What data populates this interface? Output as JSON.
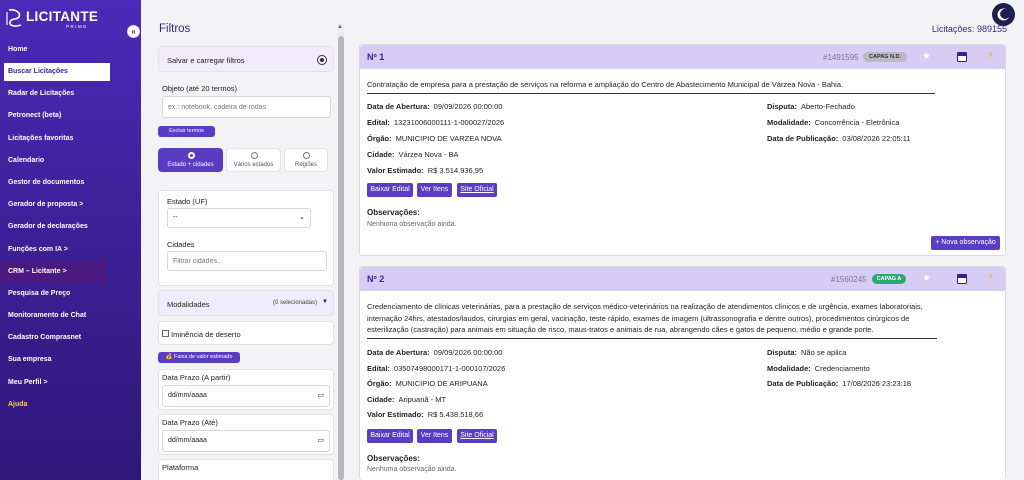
{
  "brand": {
    "name": "LICITANTE",
    "sub": "PRIME"
  },
  "sidebar": {
    "collapse_icon": "«",
    "items": [
      {
        "label": "Home"
      },
      {
        "label": "Buscar Licitações"
      },
      {
        "label": "Radar de Licitações"
      },
      {
        "label": "Petronect (beta)"
      },
      {
        "label": "Licitações favoritas"
      },
      {
        "label": "Calendario"
      },
      {
        "label": "Gestor de documentos"
      },
      {
        "label": "Gerador de proposta >"
      },
      {
        "label": "Gerador de declarações"
      },
      {
        "label": "Funções com IA >"
      },
      {
        "label": "CRM – Licitante >"
      },
      {
        "label": "Pesquisa de Preço"
      },
      {
        "label": "Monitoramento de Chat"
      },
      {
        "label": "Cadastro Comprasnet"
      },
      {
        "label": "Sua empresa"
      },
      {
        "label": "Meu Perfil >"
      },
      {
        "label": "Ajuda"
      }
    ]
  },
  "filters": {
    "title": "Filtros",
    "save_load": "Salvar e carregar filtros",
    "objeto_label": "Objeto (até 20 termos)",
    "objeto_placeholder": "ex.: notebook, cadeira de rodas",
    "excluir_termos": "Excluir termos",
    "scope_options": [
      {
        "label": "Estado + cidades",
        "selected": true
      },
      {
        "label": "Vários estados",
        "selected": false
      },
      {
        "label": "Regiões",
        "selected": false
      }
    ],
    "estado_label": "Estado (UF)",
    "estado_value": "--",
    "cidades_label": "Cidades",
    "cidades_placeholder": "Filtrar cidades...",
    "modalidades_label": "Modalidades",
    "modalidades_count": "(0 selecionadas)",
    "iminencia_label": "Iminência de deserto",
    "faixa_valor": "💰 Faixa de valor estimado",
    "prazo_inicio_label": "Data Prazo (A partir)",
    "prazo_inicio_value": "dd/mm/aaaa",
    "prazo_fim_label": "Data Prazo (Até)",
    "prazo_fim_value": "dd/mm/aaaa",
    "plataforma_label": "Plataforma"
  },
  "results": {
    "count_label": "Licitações:",
    "count": "989155"
  },
  "cards": [
    {
      "num": "Nº 1",
      "id": "#1491595",
      "badge": "CAPAG N.D.",
      "badge_color": "#b9b9c4",
      "objeto": "Contratação de empresa para a prestação de serviços na reforma e ampliação do Centro de Abastecimento Municipal de Várzea Nova - Bahia.",
      "abertura_label": "Data de Abertura:",
      "abertura": "09/09/2026 00:00:00",
      "edital_label": "Edital:",
      "edital": "13231006000111-1-000027/2026",
      "orgao_label": "Órgão:",
      "orgao": "MUNICIPIO DE VARZEA NOVA",
      "cidade_label": "Cidade:",
      "cidade": "Várzea Nova - BA",
      "valor_label": "Valor Estimado:",
      "valor": "R$ 3.514.936,95",
      "disputa_label": "Disputa:",
      "disputa": "Aberto-Fechado",
      "modalidade_label": "Modalidade:",
      "modalidade": "Concorrência - Eletrônica",
      "publicacao_label": "Data de Publicação:",
      "publicacao": "03/08/2026 22:05:11",
      "btn_edital": "Baixar Edital",
      "btn_itens": "Ver Itens",
      "btn_site": "Site Oficial",
      "obs_label": "Observações:",
      "obs_text": "Nenhuma observação ainda.",
      "add_obs": "+ Nova observação"
    },
    {
      "num": "Nº 2",
      "id": "#1560245",
      "badge": "CAPAG A",
      "badge_color": "#2ba870",
      "objeto": "Credenciamento de clínicas veterinárias, para a prestação de serviços médico-veterinários na realização de atendimentos clínicos e de urgência, exames laboratoriais, internação 24hrs, atestados/laudos, cirurgias em geral, vacinação, teste rápido, exames de imagem (ultrassonografia e dentre outros), procedimentos cirúrgicos de esterilização (castração) para animais em situação de risco, maus-tratos e animais de rua, abrangendo cães e gatos de pequeno, médio e grande porte.",
      "abertura_label": "Data de Abertura:",
      "abertura": "09/09/2026 00:00:00",
      "edital_label": "Edital:",
      "edital": "03507498000171-1-000107/2026",
      "orgao_label": "Órgão:",
      "orgao": "MUNICIPIO DE ARIPUANA",
      "cidade_label": "Cidade:",
      "cidade": "Aripuanã - MT",
      "valor_label": "Valor Estimado:",
      "valor": "R$ 5.438.518,66",
      "disputa_label": "Disputa:",
      "disputa": "Não se aplica",
      "modalidade_label": "Modalidade:",
      "modalidade": "Credenciamento",
      "publicacao_label": "Data de Publicação:",
      "publicacao": "17/08/2026 23:23:18",
      "btn_edital": "Baixar Edital",
      "btn_itens": "Ver Itens",
      "btn_site": "Site Oficial",
      "obs_label": "Observações:",
      "obs_text": "Nenhuma observação ainda."
    }
  ]
}
